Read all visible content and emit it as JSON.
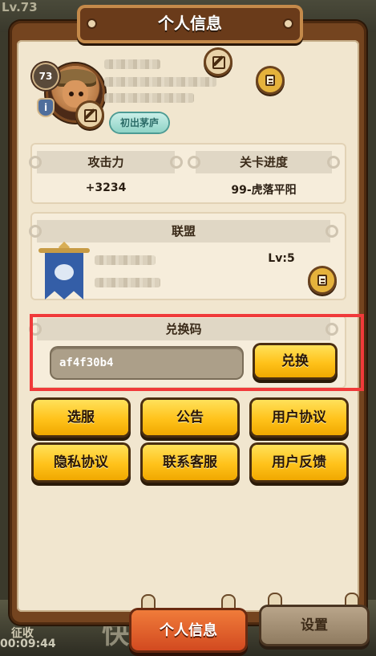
{
  "background": {
    "level_text": "Lv.73",
    "collect_text": "征收",
    "timer_text": "00:09:44",
    "quick_text": "快"
  },
  "dialog": {
    "title": "个人信息"
  },
  "profile": {
    "level": "73",
    "info_icon_label": "i",
    "title_tag": "初出茅庐"
  },
  "stats": {
    "attack_label": "攻击力",
    "attack_value": "+3234",
    "stage_label": "关卡进度",
    "stage_value": "99-虎落平阳"
  },
  "alliance": {
    "header": "联盟",
    "level": "Lv:5"
  },
  "redeem": {
    "header": "兑换码",
    "code_value": "af4f30b4",
    "button_label": "兑换"
  },
  "buttons": {
    "select_server": "选服",
    "announcement": "公告",
    "user_agreement": "用户协议",
    "privacy_policy": "隐私协议",
    "contact_support": "联系客服",
    "user_feedback": "用户反馈"
  },
  "tabs": {
    "profile": "个人信息",
    "settings": "设置"
  },
  "colors": {
    "panel_brown": "#74441f",
    "parchment": "#f1e6cf",
    "button_yellow": "#ffc21a",
    "highlight_red": "#f03a3a",
    "active_tab_orange": "#e0602b"
  },
  "icons": [
    "edit-icon",
    "notes-icon",
    "info-icon",
    "alliance-banner-icon"
  ]
}
